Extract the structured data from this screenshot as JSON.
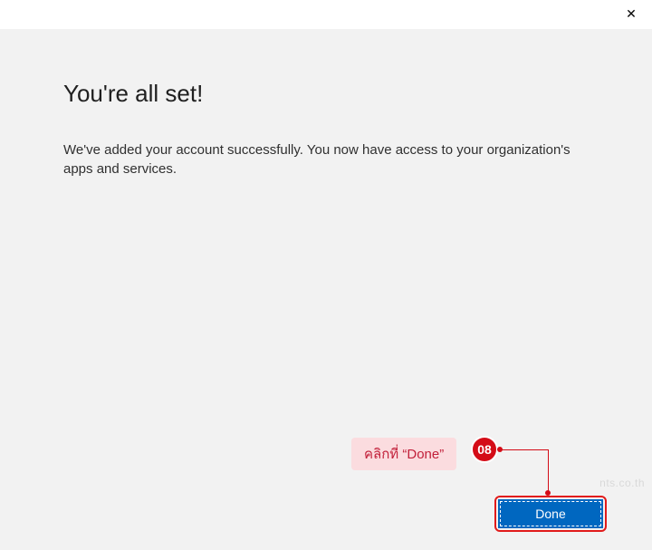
{
  "titlebar": {
    "close_glyph": "✕"
  },
  "main": {
    "title": "You're all set!",
    "description": "We've added your account successfully. You now have access to your organization's apps and services."
  },
  "footer": {
    "done_label": "Done"
  },
  "annotation": {
    "callout_text": "คลิกที่ “Done”",
    "step_number": "08",
    "highlight_color": "#e11b1b"
  },
  "watermark": "nts.co.th"
}
